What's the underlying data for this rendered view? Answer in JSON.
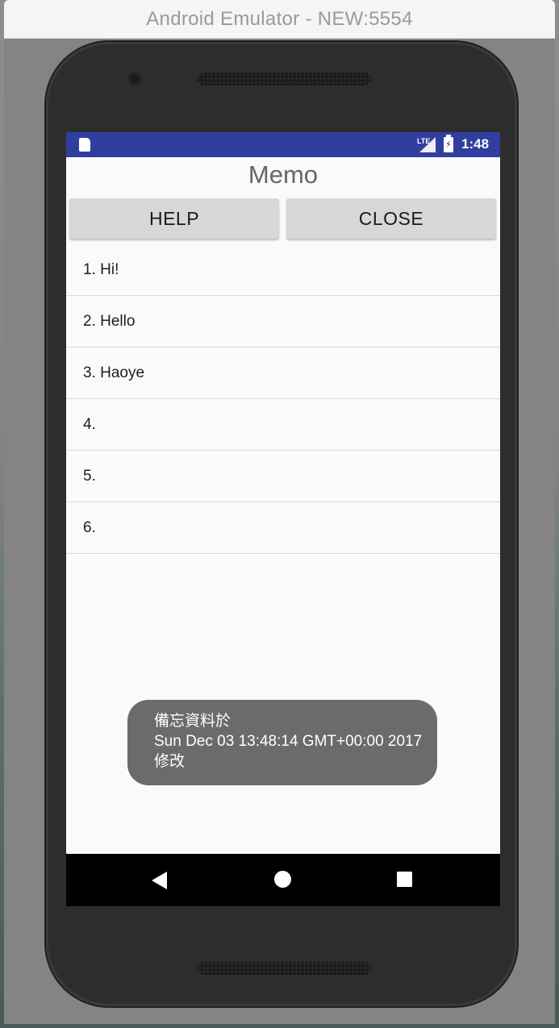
{
  "window": {
    "title": "Android Emulator - NEW:5554"
  },
  "statusbar": {
    "network": "LTE",
    "time": "1:48",
    "color": "#303f9f"
  },
  "app": {
    "title": "Memo",
    "buttons": {
      "help": "HELP",
      "close": "CLOSE"
    },
    "memos": [
      "1. Hi!",
      "2. Hello",
      "3. Haoye",
      "4.",
      "5.",
      "6."
    ]
  },
  "toast": {
    "line1": "備忘資料於",
    "line2": "Sun Dec 03 13:48:14 GMT+00:00 2017",
    "line3": " 修改"
  },
  "navbar": {
    "icons": [
      "back-icon",
      "home-icon",
      "recent-apps-icon"
    ]
  }
}
